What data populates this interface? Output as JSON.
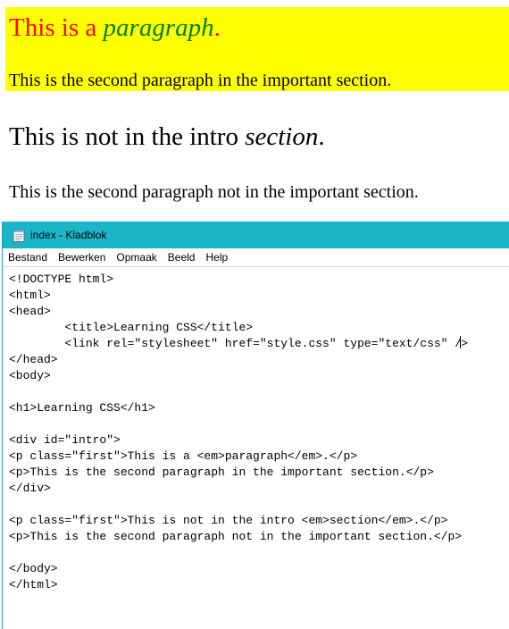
{
  "browser": {
    "intro": {
      "p1_text": "This is a ",
      "p1_em": "paragraph",
      "p1_end": ".",
      "p2": "This is the second paragraph in the important section."
    },
    "outer": {
      "p1_text": "This is not in the intro ",
      "p1_em": "section",
      "p1_end": ".",
      "p2": "This is the second paragraph not in the important section."
    }
  },
  "notepad": {
    "title": "index - Kladblok",
    "icon": "notepad-icon",
    "menu": [
      "Bestand",
      "Bewerken",
      "Opmaak",
      "Beeld",
      "Help"
    ],
    "lines": [
      "<!DOCTYPE html>",
      "<html>",
      "<head>",
      "        <title>Learning CSS</title>",
      "        <link rel=\"stylesheet\" href=\"style.css\" type=\"text/css\" />",
      "</head>",
      "<body>",
      "",
      "<h1>Learning CSS</h1>",
      "",
      "<div id=\"intro\">",
      "<p class=\"first\">This is a <em>paragraph</em>.</p>",
      "<p>This is the second paragraph in the important section.</p>",
      "</div>",
      "",
      "<p class=\"first\">This is not in the intro <em>section</em>.</p>",
      "<p>This is the second paragraph not in the important section.</p>",
      "",
      "</body>",
      "</html>"
    ]
  },
  "colors": {
    "intro_bg": "#ffff00",
    "intro_first_text": "#ff0000",
    "intro_em": "#008000",
    "titlebar": "#1ab6c8"
  }
}
